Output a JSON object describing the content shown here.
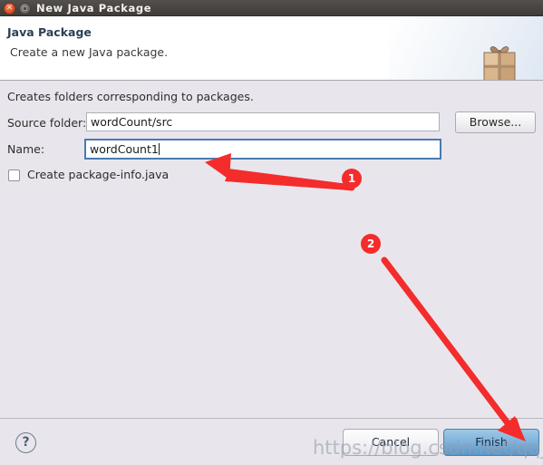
{
  "window": {
    "title": "New Java Package",
    "close_icon": "close-icon",
    "maximize_icon": "maximize-icon"
  },
  "header": {
    "title": "Java Package",
    "subtitle": "Create a new Java package.",
    "icon": "gift-package-icon"
  },
  "body": {
    "intro": "Creates folders corresponding to packages.",
    "fields": [
      {
        "label": "Source folder:",
        "value": "wordCount/src",
        "focused": false
      },
      {
        "label": "Name:",
        "value": "wordCount1",
        "focused": true
      }
    ],
    "browse_label": "Browse...",
    "checkbox": {
      "label": "Create package-info.java",
      "checked": false
    }
  },
  "footer": {
    "help_label": "?",
    "cancel_label": "Cancel",
    "finish_label": "Finish"
  },
  "annotations": {
    "badges": [
      {
        "label": "1",
        "target": "name-input"
      },
      {
        "label": "2",
        "target": "finish-button"
      }
    ],
    "color": "#f42c2c"
  },
  "watermark": {
    "text": "https://blog.csdn.net/qq_42451251"
  },
  "colors": {
    "titlebar": "#474441",
    "dialog_background": "#e8e6ec",
    "header_background": "#ffffff",
    "heading_text": "#2a3f55",
    "focus_border": "#4a7bb0",
    "default_button": "#7eb2db",
    "annotation_red": "#f42c2c"
  }
}
